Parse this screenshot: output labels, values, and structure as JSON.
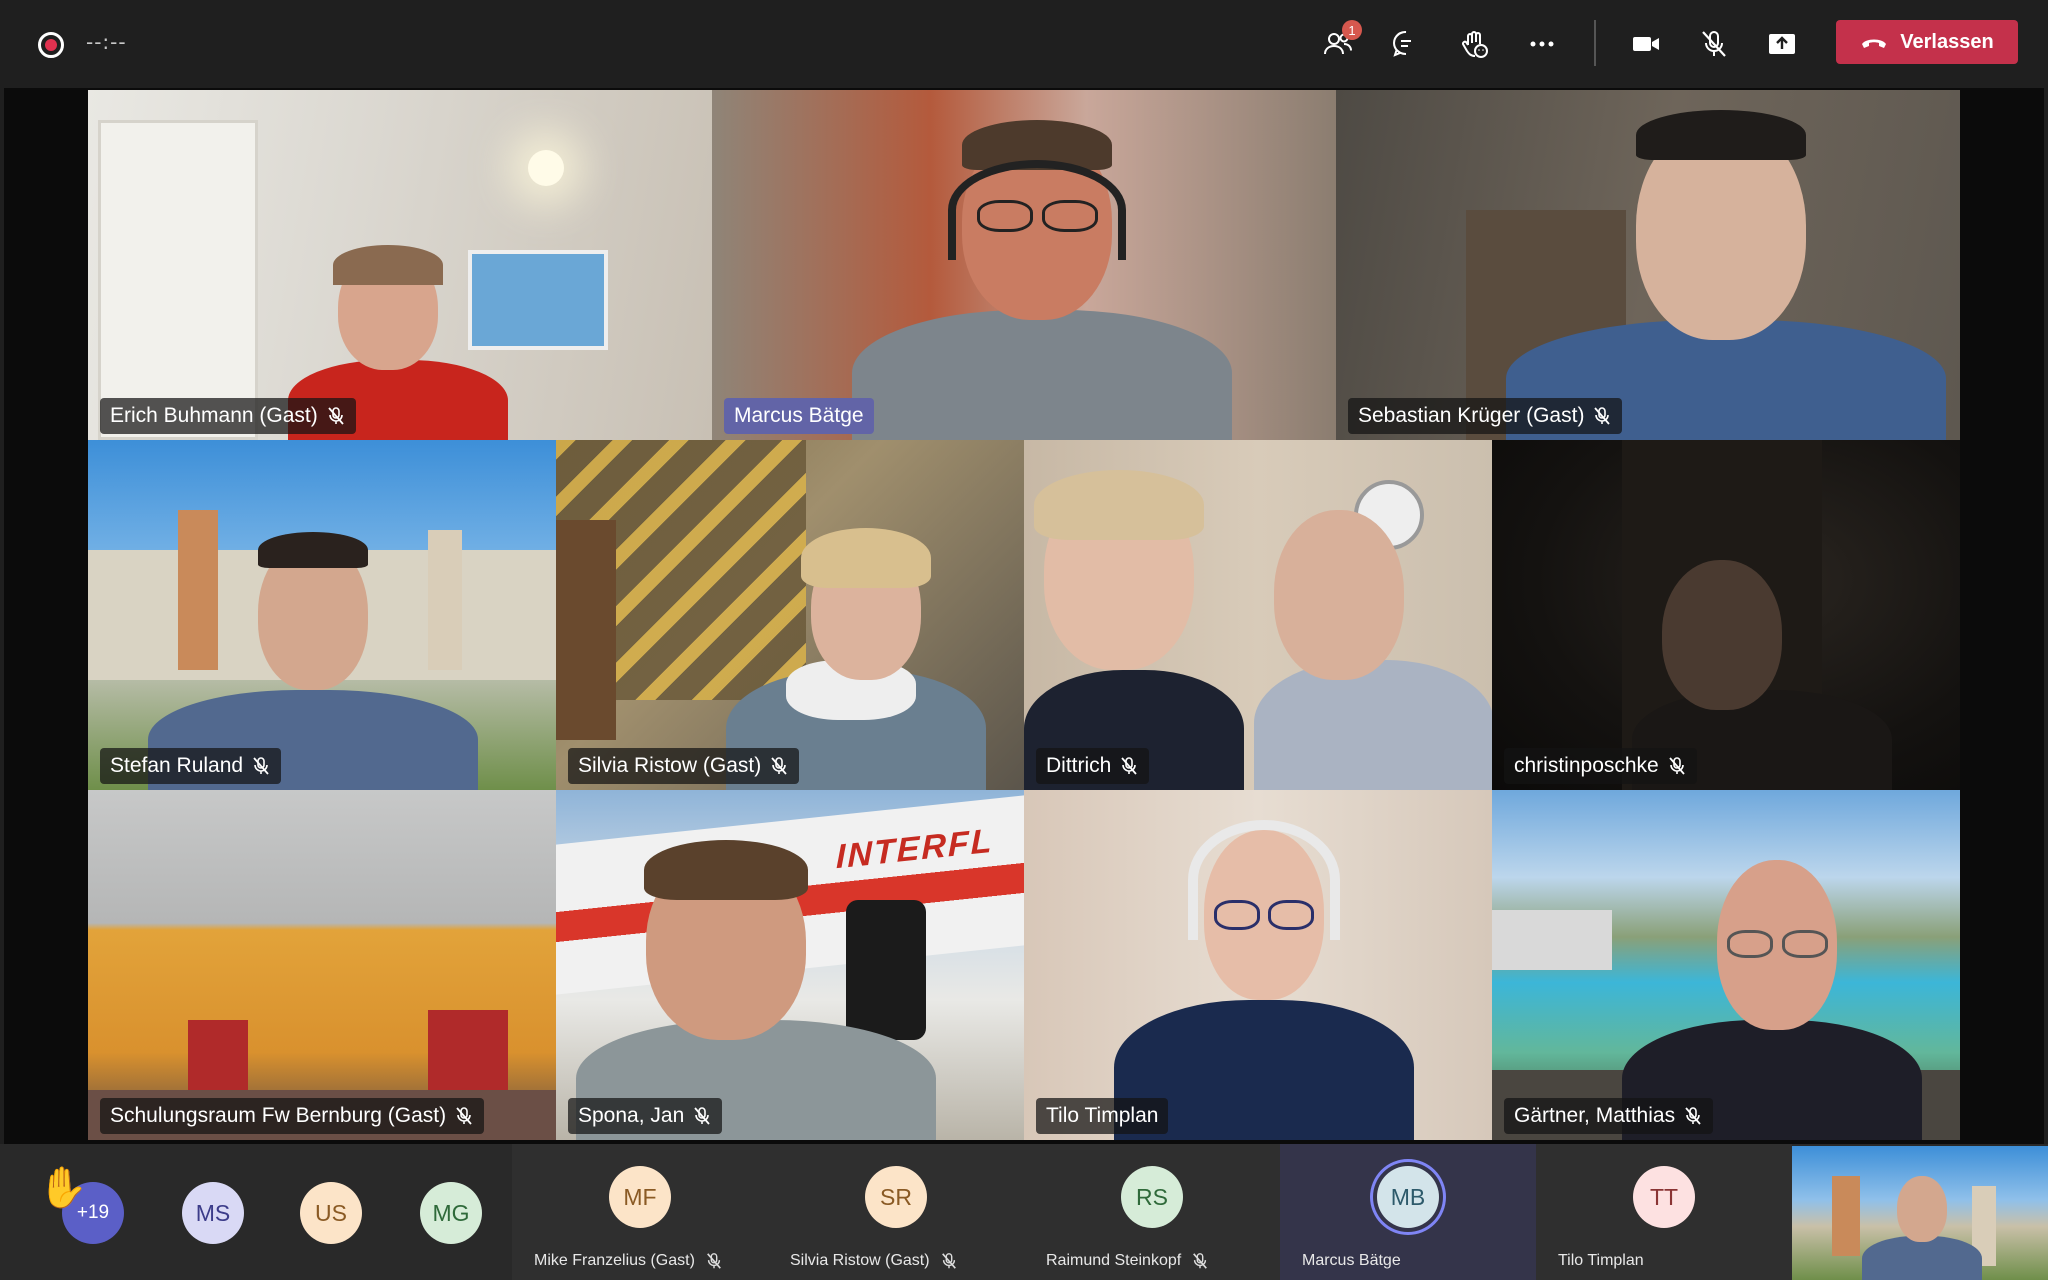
{
  "topbar": {
    "timer": "--:--",
    "participants_badge": "1",
    "leave_label": "Verlassen"
  },
  "tiles": [
    {
      "name": "Erich Buhmann (Gast)",
      "muted": true
    },
    {
      "name": "Marcus Bätge",
      "muted": false,
      "active": true
    },
    {
      "name": "Sebastian Krüger (Gast)",
      "muted": true
    },
    {
      "name": "Stefan Ruland",
      "muted": true
    },
    {
      "name": "Silvia Ristow (Gast)",
      "muted": true
    },
    {
      "name": "Dittrich",
      "muted": true
    },
    {
      "name": "christinposchke",
      "muted": true
    },
    {
      "name": "Schulungsraum Fw Bernburg (Gast)",
      "muted": true
    },
    {
      "name": "Spona, Jan",
      "muted": true
    },
    {
      "name": "Tilo Timplan",
      "muted": false
    },
    {
      "name": "Gärtner, Matthias",
      "muted": true
    }
  ],
  "tile_texts": {
    "plane_lettering": "INTERFL"
  },
  "strip": {
    "more_count": "+19",
    "avatars": [
      {
        "initials": "MS",
        "color": "#d9d9f5"
      },
      {
        "initials": "US",
        "color": "#fce4c8"
      },
      {
        "initials": "MG",
        "color": "#d6ecd8"
      }
    ],
    "tiles": [
      {
        "initials": "MF",
        "name": "Mike Franzelius (Gast)",
        "muted": true,
        "color": "#fce4c8"
      },
      {
        "initials": "SR",
        "name": "Silvia Ristow (Gast)",
        "muted": true,
        "color": "#fce4c8"
      },
      {
        "initials": "RS",
        "name": "Raimund Steinkopf",
        "muted": true,
        "color": "#d6ecd8"
      },
      {
        "initials": "MB",
        "name": "Marcus Bätge",
        "muted": false,
        "color": "#d3e4ea",
        "speaking": true
      },
      {
        "initials": "TT",
        "name": "Tilo Timplan",
        "muted": false,
        "color": "#fde1e1"
      }
    ]
  }
}
